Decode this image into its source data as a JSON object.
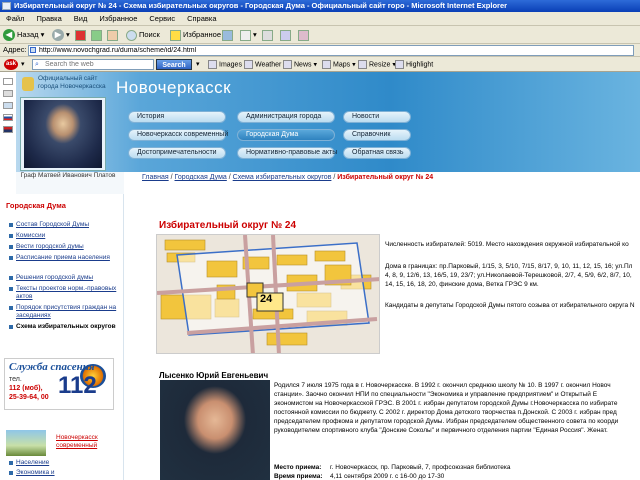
{
  "window": {
    "title": "Избирательный округ № 24 - Схема избирательных округов - Городская Дума - Официальный сайт горо - Microsoft Internet Explorer"
  },
  "menu": [
    "Файл",
    "Правка",
    "Вид",
    "Избранное",
    "Сервис",
    "Справка"
  ],
  "toolbar": {
    "back": "Назад",
    "search": "Поиск",
    "favorites": "Избранное"
  },
  "address": {
    "label": "Адрес:",
    "url": "http://www.novochgrad.ru/duma/scheme/id/24.html"
  },
  "searchbar": {
    "placeholder": "Search the web",
    "button": "Search",
    "items": [
      "Images",
      "Weather",
      "News",
      "Maps",
      "Resize",
      "Highlight"
    ]
  },
  "site": {
    "subtitle": "Официальный сайт города Новочеркасска",
    "title": "Новочеркасск",
    "portrait_caption": "Граф Матвей Иванович Платов"
  },
  "nav": [
    [
      "История",
      "Администрация города",
      "Новости"
    ],
    [
      "Новочеркасск современный",
      "Городская Дума",
      "Справочник"
    ],
    [
      "Достопримечательности",
      "Нормативно-правовые акты",
      "Обратная связь"
    ]
  ],
  "breadcrumb": {
    "items": [
      "Главная",
      "Городская Дума",
      "Схема избирательных округов"
    ],
    "current": "Избирательный округ № 24",
    "sep": " / "
  },
  "sidebar": {
    "heading": "Городская Дума",
    "links": [
      "Состав Городской Думы",
      "Комиссии",
      "Вести городской думы",
      "Расписание приема населения",
      "Решения городской думы",
      "Тексты проектов норм.-правовых актов",
      "Порядок присутствия граждан на заседаниях"
    ],
    "current": "Схема избирательных округов",
    "banner": {
      "title": "Служба спасения",
      "line1": "тел.",
      "line2": "112 (моб),",
      "line3": "25-39-64, 00",
      "number": "112"
    },
    "nov_link": "Новочеркасск современный",
    "more_links": [
      "Население",
      "Экономика и"
    ]
  },
  "content": {
    "heading": "Избирательный округ № 24",
    "map": {
      "badge": "24"
    },
    "voters": "Численность избирателей: 5019. Место нахождения окружной избирательной ко",
    "houses1": "Дома в границах: пр.Парковый, 1/15, 3, 5/10, 7/15, 8/17, 9, 10, 11, 12, 15, 16; ул.Пл",
    "houses2": "4, 8, 9, 12/6, 13, 16/5, 19, 23/7; ул.Николаевой-Терешковой, 2/7, 4, 5/9, 6/2, 8/7, 10,",
    "houses3": "14, 15, 16, 18, 20, финские дома, Ветка ГРЭС 9 км.",
    "candidates": "Кандидаты в депутаты Городской Думы пятого созыва от избирательного округа N",
    "candidate": {
      "name": "Лысенко Юрий Евгеньевич",
      "bio1": "Родился 7 июля 1975 года в г. Новочеркасске. В 1992 г. окончил среднюю школу № 10. В 1997 г. окончил Новоч",
      "bio2": "станции». Заочно окончил НПИ по специальности \"Экономика и управление предприятием\" и Открытый Е",
      "bio3": "экономистом на Новочеркасской ГРЭС. В 2001 г. избран депутатом городской Думы г.Новочеркасска по избирате",
      "bio4": "постоянной комиссии по бюджету. С 2002 г. директор Дома детского творчества п.Донской. С 2003 г. избран пред",
      "bio5": "председателем профкома и депутатом городской Думы. Избран председателем общественного совета по коорди",
      "bio6": "руководителем спортивного клуба \"Донские Соколы\" и первичного отделения партии \"Единая Россия\". Женат.",
      "place_label": "Место приема:",
      "place": "г. Новочеркасск, пр. Парковый, 7, профсоюзная библиотека",
      "time_label": "Время приема:",
      "time": "4,11 сентября 2009 г. с 16-00 до 17-30"
    }
  },
  "colors": {
    "accent": "#c00000",
    "header": "#2f8ac9",
    "link": "#1a3c8c"
  }
}
